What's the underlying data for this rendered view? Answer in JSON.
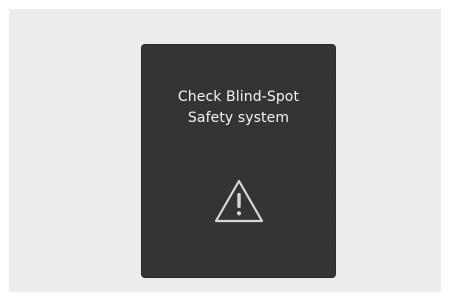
{
  "message": {
    "line1": "Check Blind-Spot",
    "line2": "Safety system"
  },
  "icons": {
    "warning": "warning-triangle-icon"
  },
  "colors": {
    "background": "#ececec",
    "panel": "#333333",
    "text": "#f3f3f3"
  }
}
